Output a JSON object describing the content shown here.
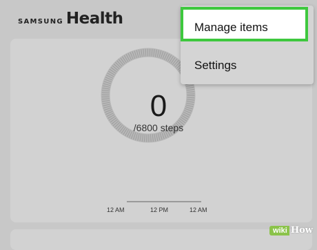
{
  "header": {
    "brand_samsung": "SAMSUNG",
    "brand_health": "Health"
  },
  "steps": {
    "count": "0",
    "goal_text": "/6800 steps",
    "progress": 0
  },
  "timeline": {
    "ticks": [
      "12 AM",
      "12 PM",
      "12 AM"
    ]
  },
  "menu": {
    "items": [
      {
        "label": "Manage items"
      },
      {
        "label": "Settings"
      }
    ]
  },
  "watermark": {
    "wiki": "wiki",
    "how": "How"
  },
  "colors": {
    "highlight": "#3ec83e",
    "background": "#c8c8c8",
    "card": "#d2d2d2"
  }
}
